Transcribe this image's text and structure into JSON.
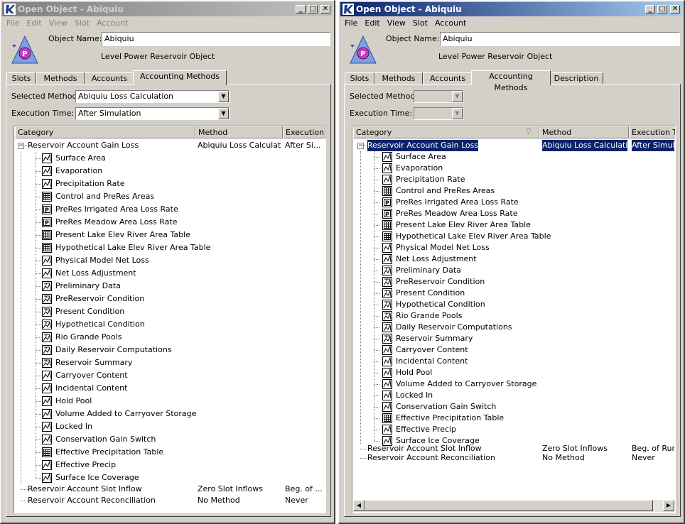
{
  "left": {
    "title": "Open Object - Abiquiu",
    "menu": [
      "File",
      "Edit",
      "View",
      "Slot",
      "Account"
    ],
    "object_name_label": "Object Name:",
    "object_name_value": "Abiquiu",
    "object_type": "Level Power Reservoir Object",
    "tabs": [
      "Slots",
      "Methods",
      "Accounts",
      "Accounting Methods"
    ],
    "selected_method_label": "Selected Method:",
    "selected_method_value": "Abiquiu Loss Calculation",
    "execution_time_label": "Execution Time:",
    "execution_time_value": "After Simulation",
    "columns": [
      "Category",
      "Method",
      "Execution"
    ],
    "root": {
      "name": "Reservoir Account Gain Loss",
      "method": "Abiquiu Loss Calculation",
      "execution": "After Si..."
    },
    "children": [
      {
        "name": "Surface Area",
        "icon": "series"
      },
      {
        "name": "Evaporation",
        "icon": "series"
      },
      {
        "name": "Precipitation Rate",
        "icon": "series"
      },
      {
        "name": "Control and PreRes Areas",
        "icon": "table"
      },
      {
        "name": "PreRes Irrigated Area Loss Rate",
        "icon": "periodic"
      },
      {
        "name": "PreRes Meadow Area Loss Rate",
        "icon": "periodic"
      },
      {
        "name": "Present Lake Elev River Area Table",
        "icon": "table"
      },
      {
        "name": "Hypothetical Lake Elev River Area Table",
        "icon": "table"
      },
      {
        "name": "Physical Model Net Loss",
        "icon": "series"
      },
      {
        "name": "Net Loss Adjustment",
        "icon": "series"
      },
      {
        "name": "Preliminary Data",
        "icon": "agg"
      },
      {
        "name": "PreReservoir Condition",
        "icon": "agg"
      },
      {
        "name": "Present Condition",
        "icon": "agg"
      },
      {
        "name": "Hypothetical Condition",
        "icon": "agg"
      },
      {
        "name": "Rio Grande Pools",
        "icon": "agg"
      },
      {
        "name": "Daily Reservoir Computations",
        "icon": "agg"
      },
      {
        "name": "Reservoir Summary",
        "icon": "agg"
      },
      {
        "name": "Carryover Content",
        "icon": "series"
      },
      {
        "name": "Incidental Content",
        "icon": "series"
      },
      {
        "name": "Hold Pool",
        "icon": "series"
      },
      {
        "name": "Volume Added to Carryover Storage",
        "icon": "series"
      },
      {
        "name": "Locked In",
        "icon": "series"
      },
      {
        "name": "Conservation Gain Switch",
        "icon": "series"
      },
      {
        "name": "Effective Precipitation Table",
        "icon": "table"
      },
      {
        "name": "Effective Precip",
        "icon": "series"
      },
      {
        "name": "Surface Ice Coverage",
        "icon": "series"
      }
    ],
    "others": [
      {
        "name": "Reservoir Account Slot Inflow",
        "method": "Zero Slot Inflows",
        "execution": "Beg. of ..."
      },
      {
        "name": "Reservoir Account Reconciliation",
        "method": "No Method",
        "execution": "Never"
      }
    ]
  },
  "right": {
    "title": "Open Object - Abiquiu",
    "menu": [
      "File",
      "Edit",
      "View",
      "Slot",
      "Account"
    ],
    "object_name_label": "Object Name:",
    "object_name_value": "Abiquiu",
    "object_type": "Level Power Reservoir Object",
    "tabs": [
      "Slots",
      "Methods",
      "Accounts",
      "Accounting Methods",
      "Description"
    ],
    "selected_method_label": "Selected Method:",
    "selected_method_value": "",
    "execution_time_label": "Execution Time:",
    "execution_time_value": "",
    "columns": [
      "Category",
      "Method",
      "Execution Tim"
    ],
    "root": {
      "name": "Reservoir Account Gain Loss",
      "method": "Abiquiu Loss Calculation",
      "execution": "After Simula"
    },
    "others": [
      {
        "name": "Reservoir Account Slot Inflow",
        "method": "Zero Slot Inflows",
        "execution": "Beg. of Run"
      },
      {
        "name": "Reservoir Account Reconciliation",
        "method": "No Method",
        "execution": "Never"
      }
    ]
  },
  "colors": {
    "title_active": "#0a246a",
    "title_inactive": "#808080",
    "face": "#d4d0c8",
    "selection": "#0a246a"
  }
}
